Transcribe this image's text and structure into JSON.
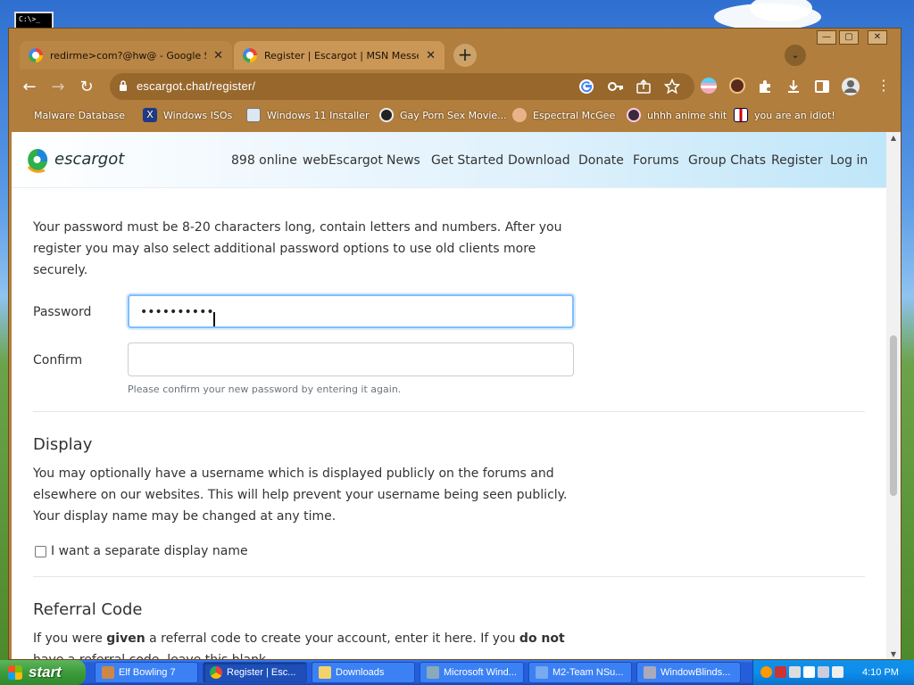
{
  "desktop": {
    "cmd_thumb_label": "C:\\>_"
  },
  "browser": {
    "tabs": [
      {
        "title": "redirme>com?@hw@ - Google Sea",
        "close": "✕"
      },
      {
        "title": "Register | Escargot | MSN Messe",
        "close": "✕"
      }
    ],
    "new_tab": "+",
    "tab_search": "⌄",
    "window_controls": {
      "minimize": "—",
      "maximize": "▢",
      "close": "✕"
    },
    "nav": {
      "back": "←",
      "forward": "→",
      "reload": "↻"
    },
    "url": "escargot.chat/register/",
    "bookmarks": [
      {
        "label": "Malware Database"
      },
      {
        "label": "Windows ISOs"
      },
      {
        "label": "Windows 11 Installer"
      },
      {
        "label": "Gay Porn Sex Movie..."
      },
      {
        "label": "Espectral McGee"
      },
      {
        "label": "uhhh anime shit"
      },
      {
        "label": "you are an idiot!"
      }
    ]
  },
  "site": {
    "brand": "escargot",
    "nav": [
      "898 online",
      "webEscargot",
      "News",
      "Get Started",
      "Download",
      "Donate",
      "Forums",
      "Group Chats",
      "Register",
      "Log in"
    ],
    "password_info": "Your password must be 8-20 characters long, contain letters and numbers. After you register you may also select additional password options to use old clients more securely.",
    "password_label": "Password",
    "password_value": "••••••••••",
    "confirm_label": "Confirm",
    "confirm_value": "",
    "confirm_hint": "Please confirm your new password by entering it again.",
    "display_heading": "Display",
    "display_info": "You may optionally have a username which is displayed publicly on the forums and elsewhere on our websites. This will help prevent your username being seen publicly. Your display name may be changed at any time.",
    "display_checkbox_label": "I want a separate display name",
    "display_checkbox_checked": false,
    "referral_heading": "Referral Code",
    "referral_text": {
      "part1": "If you were ",
      "bold1": "given",
      "part2": " a referral code to create your account, enter it here. If you ",
      "bold2": "do not",
      "part3": " have a referral code, leave this blank."
    }
  },
  "taskbar": {
    "start_label": "start",
    "tasks": [
      {
        "label": "Elf Bowling 7",
        "active": false
      },
      {
        "label": "Register | Esc...",
        "active": true
      },
      {
        "label": "Downloads",
        "active": false
      },
      {
        "label": "Microsoft Wind...",
        "active": false
      },
      {
        "label": "M2-Team NSu...",
        "active": false
      },
      {
        "label": "WindowBlinds...",
        "active": false
      }
    ],
    "clock": "4:10 PM"
  },
  "colors": {
    "accent": "#245edb",
    "start_green": "#3c9b3a",
    "focus_border": "#80bdff"
  }
}
